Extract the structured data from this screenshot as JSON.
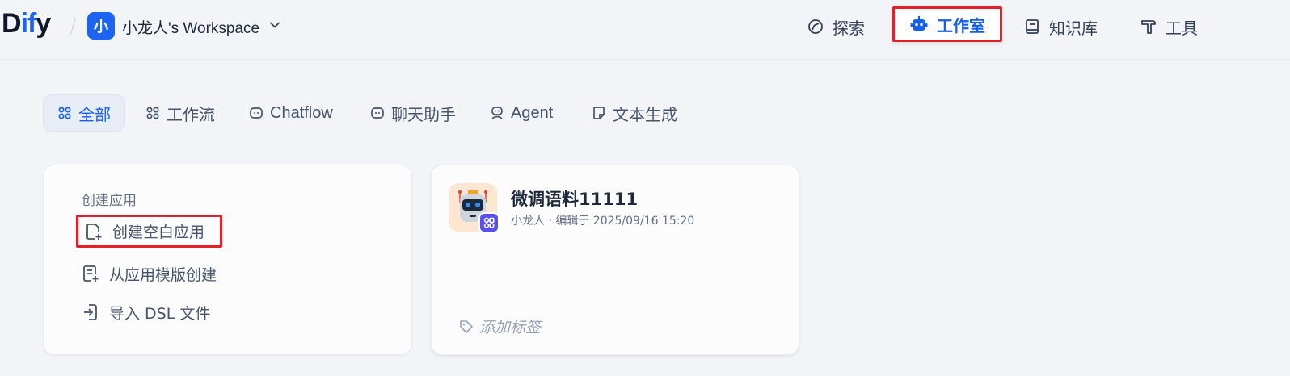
{
  "header": {
    "logo_main_1": "D",
    "logo_accent": "if",
    "logo_main_2": "y",
    "workspace_initial": "小",
    "workspace_name": "小龙人's Workspace",
    "nav": {
      "explore": "探索",
      "studio": "工作室",
      "knowledge": "知识库",
      "tools": "工具"
    }
  },
  "tabs": {
    "all": "全部",
    "workflow": "工作流",
    "chatflow": "Chatflow",
    "chat_assistant": "聊天助手",
    "agent": "Agent",
    "text_generation": "文本生成"
  },
  "create_card": {
    "heading": "创建应用",
    "blank": "创建空白应用",
    "from_template": "从应用模版创建",
    "import_dsl": "导入 DSL 文件"
  },
  "app_card": {
    "title": "微调语料11111",
    "meta": "小龙人 · 编辑于 2025/09/16 15:20",
    "add_tag": "添加标签"
  },
  "colors": {
    "accent": "#155eef",
    "highlight_border": "#e41f2a",
    "page_bg": "#f2f4f7"
  }
}
